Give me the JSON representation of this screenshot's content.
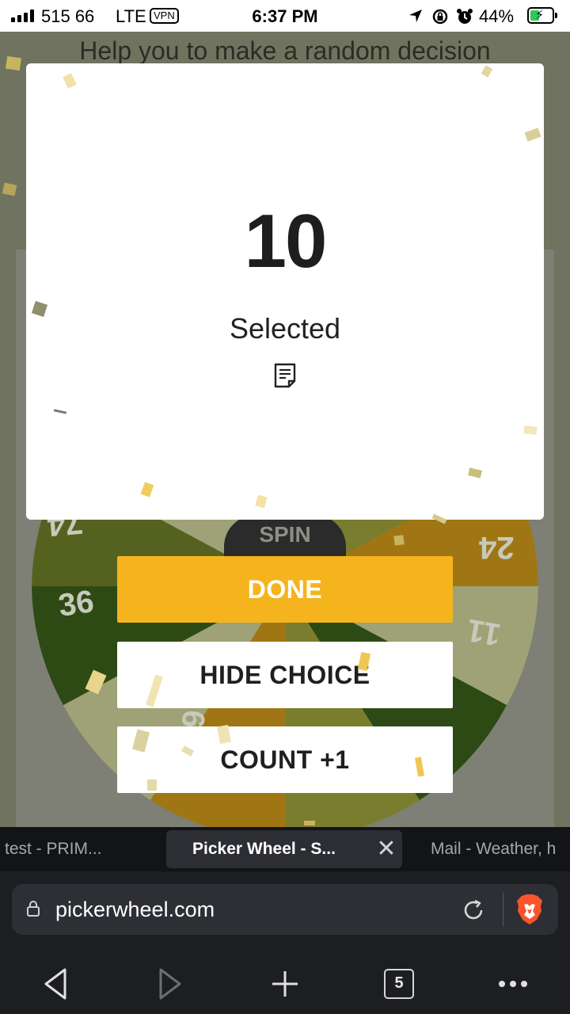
{
  "status_bar": {
    "carrier": "515 66",
    "network": "LTE",
    "vpn": "VPN",
    "time": "6:37 PM",
    "battery_percent": "44%",
    "battery_level": 0.44,
    "icons": [
      "signal-icon",
      "location-icon",
      "orientation-lock-icon",
      "alarm-icon",
      "battery-charging-icon"
    ]
  },
  "page": {
    "heading": "Help you to make a random decision"
  },
  "wheel": {
    "visible_numbers": [
      "74",
      "24",
      "36",
      "11",
      "6"
    ],
    "spin_label": "SPIN",
    "colors": [
      "#9ea276",
      "#7b7d2e",
      "#2e4a14",
      "#a07614",
      "#55621f"
    ]
  },
  "modal": {
    "result": "10",
    "result_label": "Selected",
    "note_icon": "note-icon"
  },
  "actions": {
    "done": "DONE",
    "hide_choice": "HIDE CHOICE",
    "count": "COUNT +1"
  },
  "browser": {
    "tabs": [
      {
        "label": "test - PRIM..."
      },
      {
        "label": "Picker Wheel - S...",
        "active": true
      },
      {
        "label": "Mail - Weather, h"
      }
    ],
    "url": "pickerwheel.com",
    "tab_count": "5",
    "accent": "#f5b41e"
  }
}
